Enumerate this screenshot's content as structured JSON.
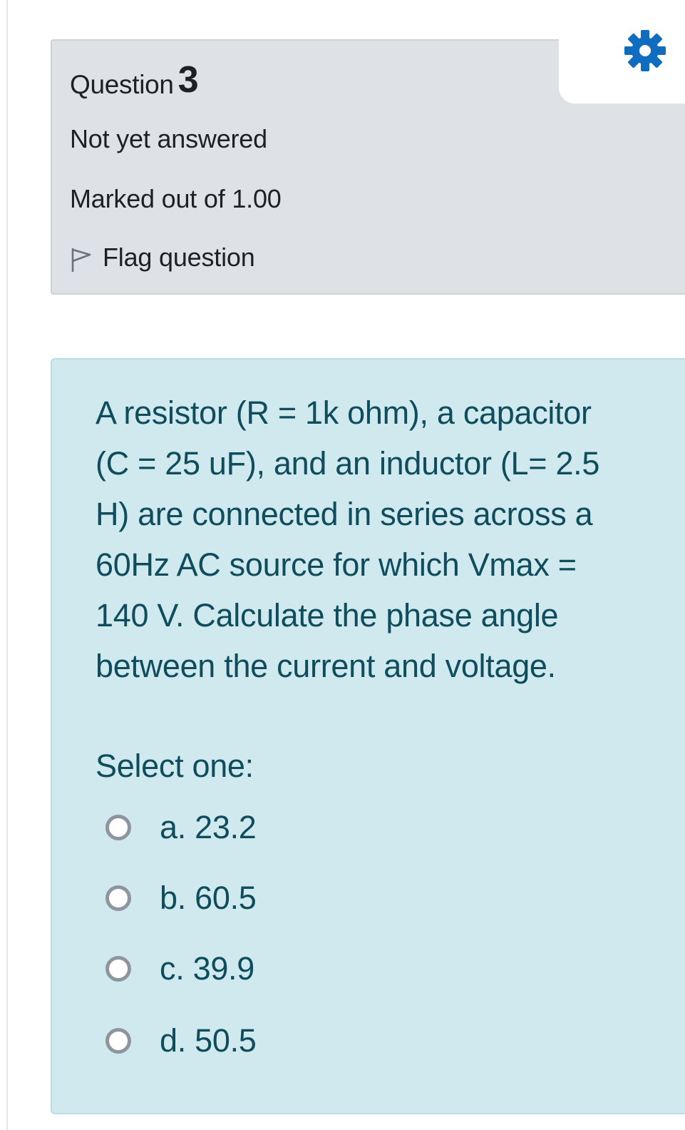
{
  "info": {
    "question_label": "Question",
    "question_number": "3",
    "state": "Not yet answered",
    "grade": "Marked out of 1.00",
    "flag_label": "Flag question"
  },
  "icons": {
    "settings": "gear-icon",
    "flag": "flag-outline-icon"
  },
  "colors": {
    "accent": "#0f6cbf",
    "info_bg": "#dee2e6",
    "content_bg": "#cfe9ef",
    "content_text": "#0f4d5c"
  },
  "question": {
    "text_lines": [
      "A resistor (R = 1k ohm), a capacitor",
      "(C = 25 uF), and an inductor (L= 2.5",
      "H) are connected in series across a",
      "60Hz AC source for which Vmax =",
      "140 V. Calculate the phase angle",
      "between the current and voltage."
    ],
    "prompt": "Select one:",
    "options": [
      {
        "label": "a. 23.2"
      },
      {
        "label": "b. 60.5"
      },
      {
        "label": "c. 39.9"
      },
      {
        "label": "d. 50.5"
      }
    ]
  }
}
